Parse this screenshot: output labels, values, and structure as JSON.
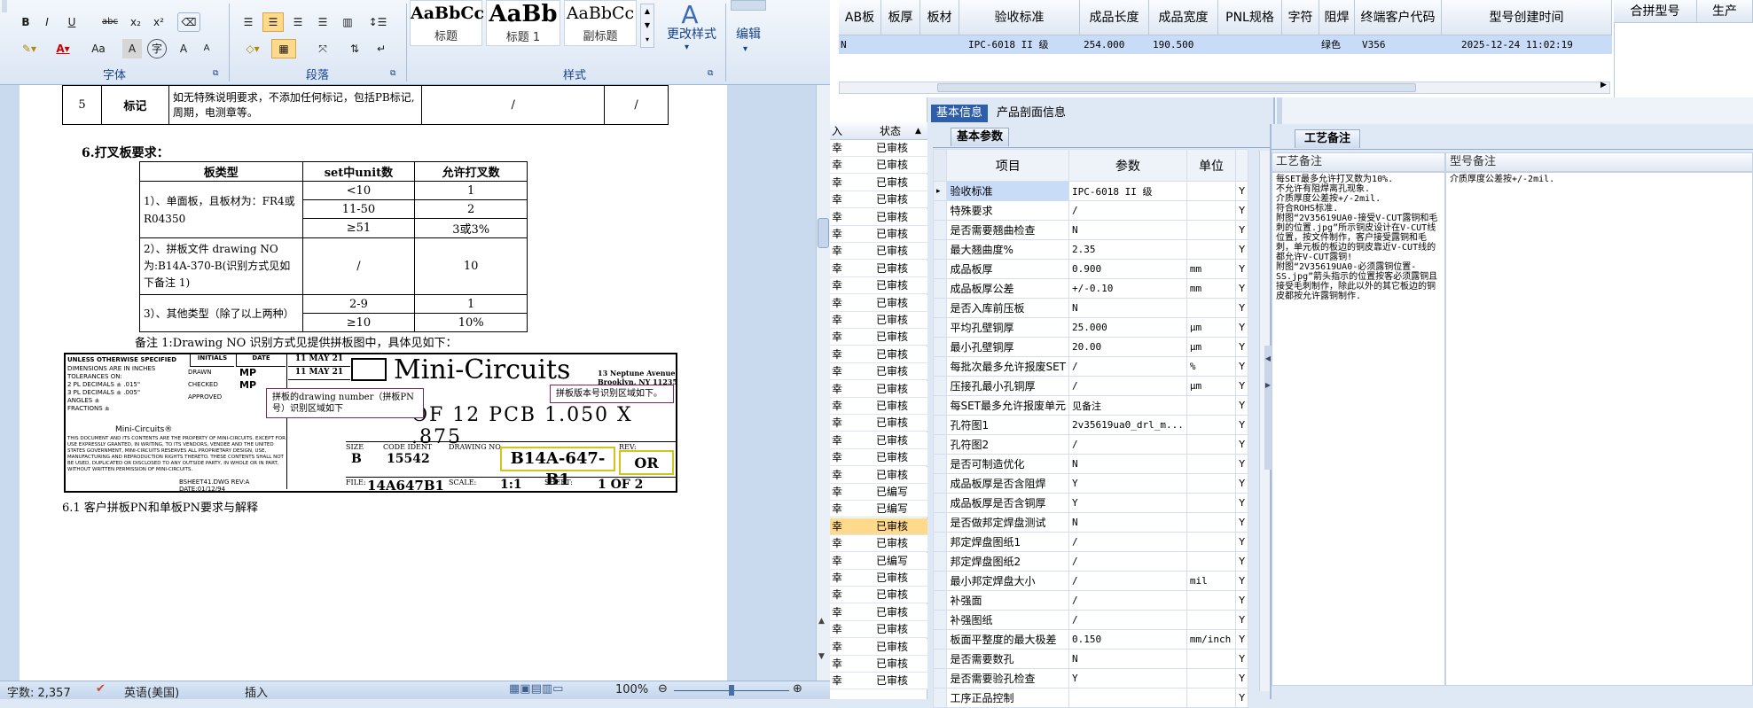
{
  "word": {
    "ribbon": {
      "font_group_label": "字体",
      "paragraph_group_label": "段落",
      "styles_group_label": "样式",
      "font_buttons": [
        "B",
        "I",
        "U",
        "abc",
        "x₂",
        "x²",
        "Aa",
        "A",
        "A",
        "A"
      ],
      "styles": [
        {
          "preview": "AaBbCc",
          "name": "标题"
        },
        {
          "preview": "AaBb",
          "name": "标题 1"
        },
        {
          "preview": "AaBbCc",
          "name": "副标题"
        }
      ],
      "change_styles_label": "更改样式",
      "edit_label": "编辑"
    },
    "doc": {
      "top_row": {
        "num": "5",
        "item": "标记",
        "desc": "如无特殊说明要求，不添加任何标记，包括PB标记,周期，电测章等。",
        "c4": "/",
        "c5": "/"
      },
      "section_heading": "6.打叉板要求：",
      "xtable": {
        "headers": [
          "板类型",
          "set中unit数",
          "允许打叉数"
        ],
        "rows": [
          {
            "type": "1）、单面板，且板材为：FR4或R04350",
            "sub": [
              {
                "units": "<10",
                "allowed": "1"
              },
              {
                "units": "11-50",
                "allowed": "2"
              },
              {
                "units": "≥51",
                "allowed": "3或3%"
              }
            ]
          },
          {
            "type": "2）、拼板文件 drawing NO为:B14A-370-B(识别方式见如下备注 1)",
            "sub": [
              {
                "units": "/",
                "allowed": "10"
              }
            ]
          },
          {
            "type": "3）、其他类型（除了以上两种）",
            "sub": [
              {
                "units": "2-9",
                "allowed": "1"
              },
              {
                "units": "≥10",
                "allowed": "10%"
              }
            ]
          }
        ]
      },
      "note1": "备注 1:Drawing NO 识别方式见提供拼板图中，具体见如下：",
      "drawing": {
        "logo": "Mini-Circuits",
        "address": "13 Neptune Avenue Brooklyn, NY 11235",
        "title_partial": "OF 12 PCB 1.050 X .875",
        "size": "B",
        "code_ident": "15542",
        "drawing_no": "B14A-647-B1",
        "rev": "OR",
        "file": "14A647B1",
        "scale": "1:1",
        "sheet": "1 OF 2",
        "initials": [
          "MP",
          "MP"
        ],
        "dates": [
          "11 MAY 21",
          "11 MAY 21"
        ],
        "labels": [
          "UNLESS OTHERWISE SPECIFIED",
          "INITIALS",
          "DATE",
          "DRAWN",
          "CHECKED",
          "APPROVED",
          "SIZE",
          "CODE IDENT",
          "DRAWING NO.",
          "REV:",
          "FILE:",
          "SCALE:",
          "SHEET:"
        ],
        "tolerance_text": "DIMENSIONS ARE IN INCHES\nTOLERANCES ON:\n2 PL DECIMALS ± .015\"\n3 PL DECIMALS ± .005\"\nANGLES ±\nFRACTIONS ±",
        "prop_text": "THIS DOCUMENT AND ITS CONTENTS ARE THE PROPERTY OF MINI-CIRCUITS. EXCEPT FOR USE EXPRESSLY GRANTED, IN WRITING, TO ITS VENDORS, VENDEE AND THE UNITED STATES GOVERNMENT, MINI-CIRCUITS RESERVES ALL PROPRIETARY DESIGN, USE, MANUFACTURING AND REPRODUCTION RIGHTS THERETO. THESE CONTENTS SHALL NOT BE USED, DUPLICATED OR DISCLOSED TO ANY OUTSIDE PARTY, IN WHOLE OR IN PART, WITHOUT WRITTEN PERMISSION OF MINI-CIRCUITS.",
        "footer": "BSHEET41.DWG REV:A  DATE:01/12/94",
        "mini_logo": "Mini-Circuits®",
        "callout1": "拼板的drawing number（拼板PN号）识别区域如下",
        "callout2": "拼板版本号识别区域如下。"
      },
      "section_6_1": "6.1 客户拼板PN和单板PN要求与解释"
    },
    "status": {
      "words": "字数: 2,357",
      "lang": "英语(美国)",
      "mode": "插入",
      "zoom": "100%"
    }
  },
  "erp": {
    "grid": {
      "headers": [
        "AB板",
        "板厚",
        "板材",
        "验收标准",
        "成品长度",
        "成品宽度",
        "PNL规格",
        "字符",
        "阻焊",
        "终端客户代码",
        "型号创建时间"
      ],
      "row": {
        "n": "N",
        "std": "IPC-6018 II 级",
        "len": "254.000",
        "wid": "190.500",
        "solder": "绿色",
        "cust": "V356",
        "time": "2025-12-24 11:02:19"
      },
      "right_headers": [
        "合拼型号",
        "生产"
      ]
    },
    "left_list": {
      "headers": [
        "入",
        "状态"
      ],
      "rows": [
        {
          "a": "幸",
          "b": "已审核"
        },
        {
          "a": "幸",
          "b": "已审核"
        },
        {
          "a": "幸",
          "b": "已审核"
        },
        {
          "a": "幸",
          "b": "已审核"
        },
        {
          "a": "幸",
          "b": "已审核"
        },
        {
          "a": "幸",
          "b": "已审核"
        },
        {
          "a": "幸",
          "b": "已审核"
        },
        {
          "a": "幸",
          "b": "已审核"
        },
        {
          "a": "幸",
          "b": "已审核"
        },
        {
          "a": "幸",
          "b": "已审核"
        },
        {
          "a": "幸",
          "b": "已审核"
        },
        {
          "a": "幸",
          "b": "已审核"
        },
        {
          "a": "幸",
          "b": "已审核"
        },
        {
          "a": "幸",
          "b": "已审核"
        },
        {
          "a": "幸",
          "b": "已审核"
        },
        {
          "a": "幸",
          "b": "已审核"
        },
        {
          "a": "幸",
          "b": "已审核"
        },
        {
          "a": "幸",
          "b": "已审核"
        },
        {
          "a": "幸",
          "b": "已审核"
        },
        {
          "a": "幸",
          "b": "已审核"
        },
        {
          "a": "幸",
          "b": "已编写"
        },
        {
          "a": "幸",
          "b": "已编写"
        },
        {
          "a": "幸",
          "b": "已审核"
        },
        {
          "a": "幸",
          "b": "已审核"
        },
        {
          "a": "幸",
          "b": "已编写"
        },
        {
          "a": "幸",
          "b": "已审核"
        },
        {
          "a": "幸",
          "b": "已审核"
        },
        {
          "a": "幸",
          "b": "已审核"
        },
        {
          "a": "幸",
          "b": "已审核"
        },
        {
          "a": "幸",
          "b": "已审核"
        },
        {
          "a": "幸",
          "b": "已审核"
        },
        {
          "a": "幸",
          "b": "已审核"
        }
      ]
    },
    "tabs": {
      "basic": "基本信息",
      "section": "产品剖面信息"
    },
    "subtab": "基本参数",
    "param_headers": [
      "项目",
      "参数",
      "单位"
    ],
    "params": [
      {
        "item": "验收标准",
        "val": "IPC-6018 II 级",
        "unit": "",
        "flag": "Y"
      },
      {
        "item": "特殊要求",
        "val": "/",
        "unit": "",
        "flag": "Y"
      },
      {
        "item": "是否需要翘曲检查",
        "val": "N",
        "unit": "",
        "flag": "Y"
      },
      {
        "item": "最大翘曲度%",
        "val": "2.35",
        "unit": "",
        "flag": "Y"
      },
      {
        "item": "成品板厚",
        "val": "0.900",
        "unit": "mm",
        "flag": "Y"
      },
      {
        "item": "成品板厚公差",
        "val": "+/-0.10",
        "unit": "mm",
        "flag": "Y"
      },
      {
        "item": "是否入库前压板",
        "val": "N",
        "unit": "",
        "flag": "Y"
      },
      {
        "item": "平均孔壁铜厚",
        "val": "25.000",
        "unit": "μm",
        "flag": "Y"
      },
      {
        "item": "最小孔壁铜厚",
        "val": "20.00",
        "unit": "μm",
        "flag": "Y"
      },
      {
        "item": "每批次最多允许报废SET",
        "val": "/",
        "unit": "%",
        "flag": "Y"
      },
      {
        "item": "压接孔最小孔铜厚",
        "val": "/",
        "unit": "μm",
        "flag": "Y"
      },
      {
        "item": "每SET最多允许报废单元",
        "val": "见备注",
        "unit": "",
        "flag": "Y"
      },
      {
        "item": "孔符图1",
        "val": "2v35619ua0_drl_m...",
        "unit": "",
        "flag": "Y"
      },
      {
        "item": "孔符图2",
        "val": "/",
        "unit": "",
        "flag": "Y"
      },
      {
        "item": "是否可制造优化",
        "val": "N",
        "unit": "",
        "flag": "Y"
      },
      {
        "item": "成品板厚是否含阻焊",
        "val": "Y",
        "unit": "",
        "flag": "Y"
      },
      {
        "item": "成品板厚是否含铜厚",
        "val": "Y",
        "unit": "",
        "flag": "Y"
      },
      {
        "item": "是否做邦定焊盘测试",
        "val": "N",
        "unit": "",
        "flag": "Y"
      },
      {
        "item": "邦定焊盘图纸1",
        "val": "/",
        "unit": "",
        "flag": "Y"
      },
      {
        "item": "邦定焊盘图纸2",
        "val": "/",
        "unit": "",
        "flag": "Y"
      },
      {
        "item": "最小邦定焊盘大小",
        "val": "/",
        "unit": "mil",
        "flag": "Y"
      },
      {
        "item": "补强面",
        "val": "/",
        "unit": "",
        "flag": "Y"
      },
      {
        "item": "补强图纸",
        "val": "/",
        "unit": "",
        "flag": "Y"
      },
      {
        "item": "板面平整度的最大极差",
        "val": "0.150",
        "unit": "mm/inch",
        "flag": "Y"
      },
      {
        "item": "是否需要数孔",
        "val": "N",
        "unit": "",
        "flag": "Y"
      },
      {
        "item": "是否需要验孔检查",
        "val": "Y",
        "unit": "",
        "flag": "Y"
      },
      {
        "item": "工序正品控制",
        "val": "",
        "unit": "",
        "flag": "Y"
      }
    ],
    "craft_tab": "工艺备注",
    "craft_headers": [
      "工艺备注",
      "型号备注"
    ],
    "craft_note": "每SET最多允许打叉数为10%.\n不允许有阻焊离孔现象.\n介质厚度公差按+/-2mil.\n符合ROHS标准.\n附图“2V35619UA0-接受V-CUT露铜和毛刺的位置.jpg”所示铜皮设计在V-CUT线位置，按文件制作，客户接受露铜和毛刺，单元板的板边的铜皮靠近V-CUT线的都允许V-CUT露铜!\n附图“2V35619UA0-必须露铜位置-SS.jpg”箭头指示的位置按客必须露铜且接受毛刺制作，除此以外的其它板边的铜皮都按允许露铜制作.",
    "model_note": "介质厚度公差按+/-2mil."
  }
}
